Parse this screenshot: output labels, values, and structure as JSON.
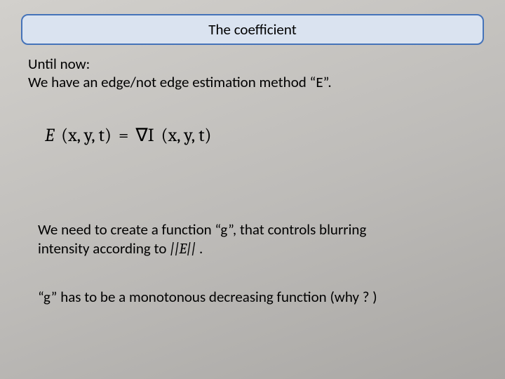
{
  "title": "The coefficient",
  "intro_line1": "Until now:",
  "intro_line2": "We have an edge/not edge estimation method “E”.",
  "equation": {
    "lhs_sym": "E",
    "args": "(x, y, t)",
    "eq": "=",
    "grad": "∇I",
    "rhs_args": "(x, y, t)"
  },
  "need_line1": "We need to create a function “g”, that controls blurring",
  "need_line2_prefix": "intensity according to ",
  "need_norm": "||E||",
  "need_line2_suffix": " .",
  "mono_line": "“g” has to be a monotonous decreasing function (why ? )"
}
